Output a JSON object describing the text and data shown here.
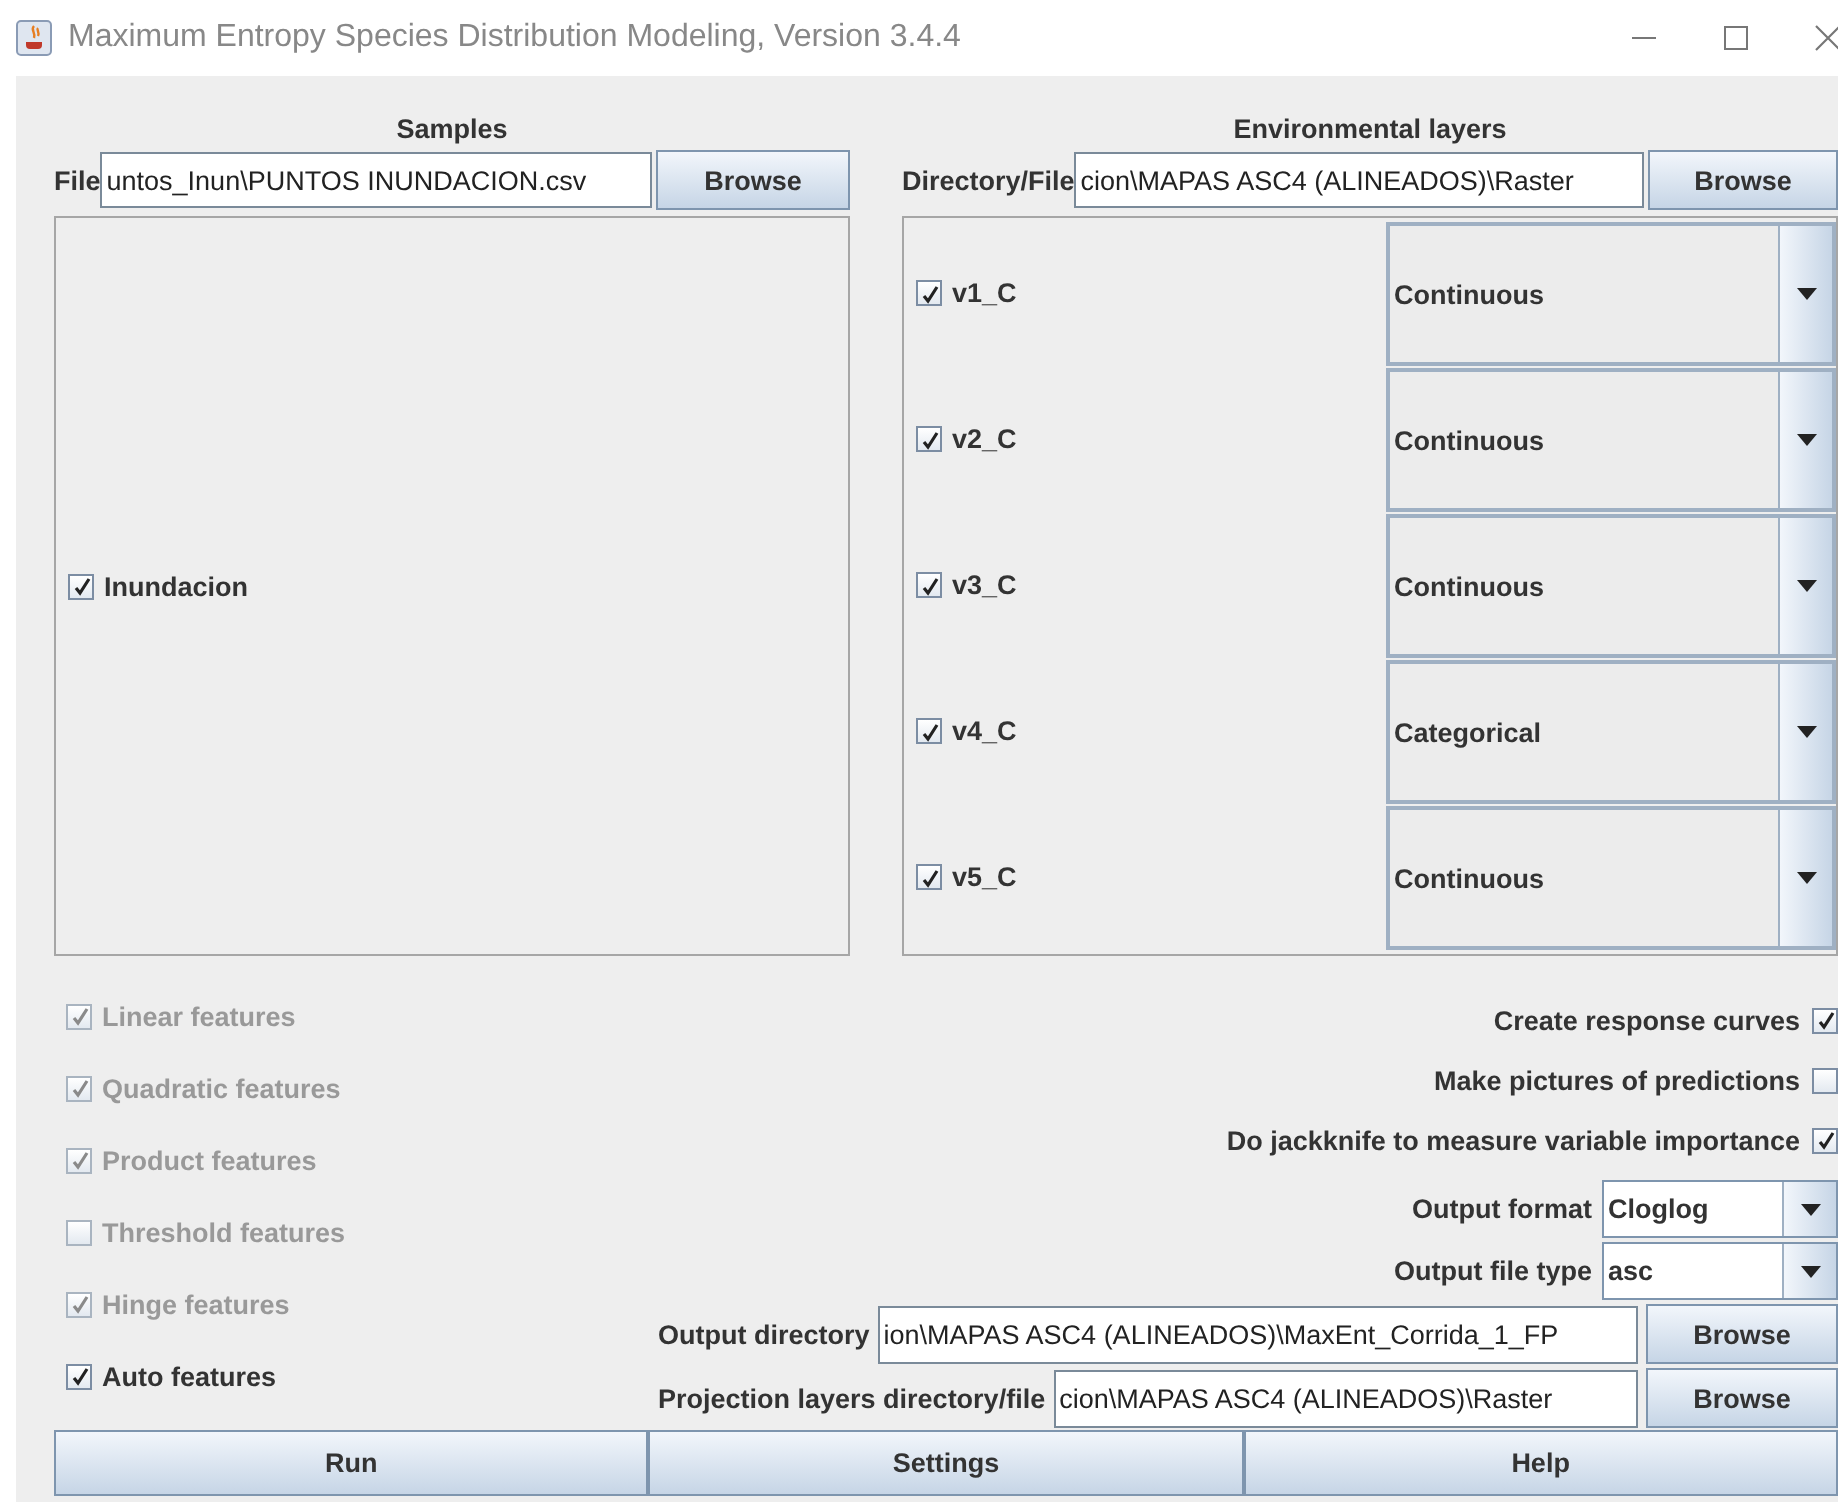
{
  "window": {
    "title": "Maximum Entropy Species Distribution Modeling, Version 3.4.4"
  },
  "samples": {
    "heading": "Samples",
    "file_label": "File",
    "file_value": "untos_Inun\\PUNTOS INUNDACION.csv",
    "browse": "Browse",
    "items": [
      {
        "label": "Inundacion",
        "checked": true
      }
    ]
  },
  "environmental": {
    "heading": "Environmental layers",
    "dir_label": "Directory/File",
    "dir_value": "cion\\MAPAS ASC4 (ALINEADOS)\\Raster",
    "browse": "Browse",
    "layers": [
      {
        "name": "v1_C",
        "checked": true,
        "type": "Continuous"
      },
      {
        "name": "v2_C",
        "checked": true,
        "type": "Continuous"
      },
      {
        "name": "v3_C",
        "checked": true,
        "type": "Continuous"
      },
      {
        "name": "v4_C",
        "checked": true,
        "type": "Categorical"
      },
      {
        "name": "v5_C",
        "checked": true,
        "type": "Continuous"
      }
    ]
  },
  "features": [
    {
      "label": "Linear features",
      "checked": true,
      "disabled": true
    },
    {
      "label": "Quadratic features",
      "checked": true,
      "disabled": true
    },
    {
      "label": "Product features",
      "checked": true,
      "disabled": true
    },
    {
      "label": "Threshold features",
      "checked": false,
      "disabled": true
    },
    {
      "label": "Hinge features",
      "checked": true,
      "disabled": true
    },
    {
      "label": "Auto features",
      "checked": true,
      "disabled": false
    }
  ],
  "options": [
    {
      "label": "Create response curves",
      "checked": true
    },
    {
      "label": "Make pictures of predictions",
      "checked": false
    },
    {
      "label": "Do jackknife to measure variable importance",
      "checked": true
    }
  ],
  "selects": [
    {
      "label": "Output format",
      "value": "Cloglog"
    },
    {
      "label": "Output file type",
      "value": "asc"
    }
  ],
  "paths": [
    {
      "label": "Output directory",
      "value": "ion\\MAPAS ASC4 (ALINEADOS)\\MaxEnt_Corrida_1_FP",
      "browse": "Browse"
    },
    {
      "label": "Projection layers directory/file",
      "value": "cion\\MAPAS ASC4 (ALINEADOS)\\Raster",
      "browse": "Browse"
    }
  ],
  "buttons": [
    "Run",
    "Settings",
    "Help"
  ]
}
